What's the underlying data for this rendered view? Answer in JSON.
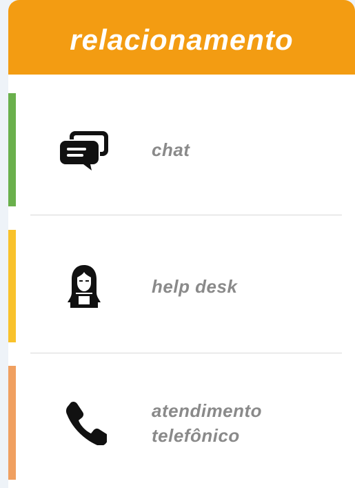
{
  "header": {
    "title": "relacionamento",
    "color": "#f39c12"
  },
  "items": [
    {
      "label": "chat",
      "icon": "chat-bubbles-icon",
      "accent": "#6ab04c"
    },
    {
      "label": "help desk",
      "icon": "helpdesk-woman-icon",
      "accent": "#f9c22b"
    },
    {
      "label_line1": "atendimento",
      "label_line2": "telefônico",
      "icon": "phone-icon",
      "accent": "#f0a060"
    }
  ]
}
